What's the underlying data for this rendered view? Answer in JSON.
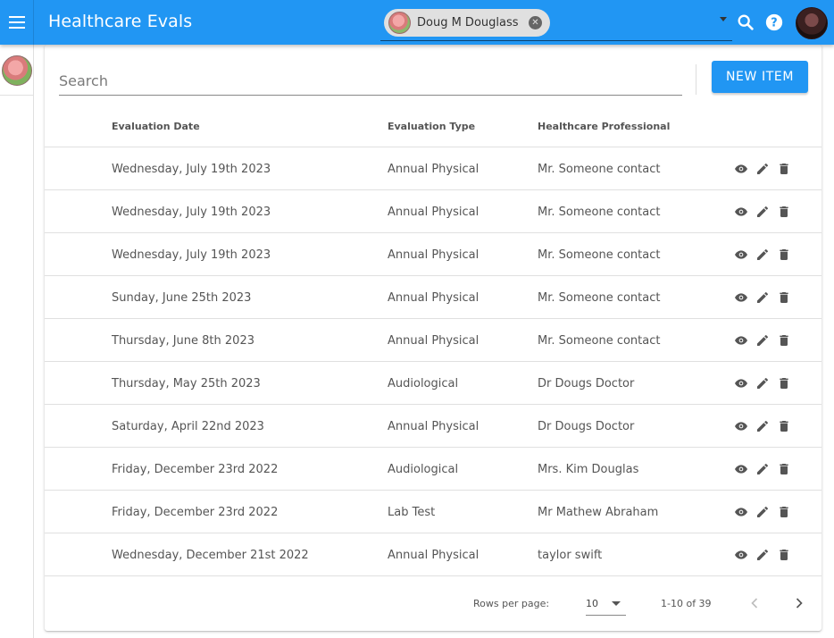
{
  "app": {
    "title": "Healthcare Evals"
  },
  "client_selector": {
    "selected": "Doug M Douglass"
  },
  "search": {
    "placeholder": "Search"
  },
  "toolbar": {
    "new_item_label": "NEW ITEM"
  },
  "table": {
    "columns": [
      "Evaluation Date",
      "Evaluation Type",
      "Healthcare Professional"
    ],
    "rows": [
      {
        "date": "Wednesday, July 19th 2023",
        "type": "Annual Physical",
        "professional": "Mr. Someone contact"
      },
      {
        "date": "Wednesday, July 19th 2023",
        "type": "Annual Physical",
        "professional": "Mr. Someone contact"
      },
      {
        "date": "Wednesday, July 19th 2023",
        "type": "Annual Physical",
        "professional": "Mr. Someone contact"
      },
      {
        "date": "Sunday, June 25th 2023",
        "type": "Annual Physical",
        "professional": "Mr. Someone contact"
      },
      {
        "date": "Thursday, June 8th 2023",
        "type": "Annual Physical",
        "professional": "Mr. Someone contact"
      },
      {
        "date": "Thursday, May 25th 2023",
        "type": "Audiological",
        "professional": "Dr Dougs Doctor"
      },
      {
        "date": "Saturday, April 22nd 2023",
        "type": "Annual Physical",
        "professional": "Dr Dougs Doctor"
      },
      {
        "date": "Friday, December 23rd 2022",
        "type": "Audiological",
        "professional": "Mrs. Kim Douglas"
      },
      {
        "date": "Friday, December 23rd 2022",
        "type": "Lab Test",
        "professional": "Mr Mathew Abraham"
      },
      {
        "date": "Wednesday, December 21st 2022",
        "type": "Annual Physical",
        "professional": "taylor swift"
      }
    ]
  },
  "pagination": {
    "rows_per_page_label": "Rows per page:",
    "rows_per_page": "10",
    "range": "1-10 of 39"
  },
  "colors": {
    "primary": "#2196f3",
    "chip": "#e0e0e0"
  },
  "icons": [
    "menu-icon",
    "search-icon",
    "help-icon",
    "eye-icon",
    "pencil-icon",
    "trash-icon",
    "chevron-left-icon",
    "chevron-right-icon"
  ]
}
